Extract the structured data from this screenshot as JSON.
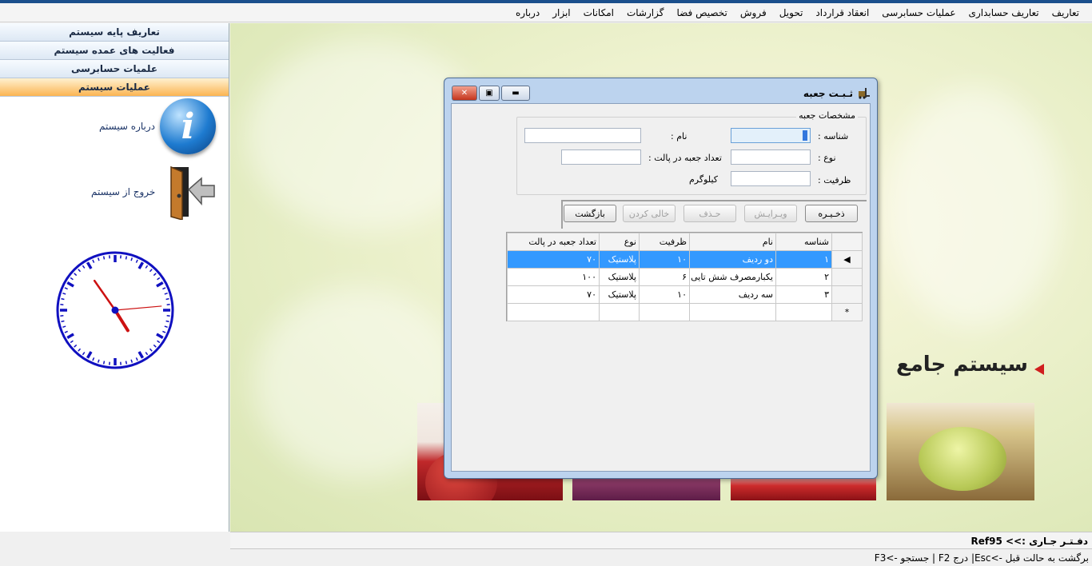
{
  "menu": [
    "تعاریف",
    "تعاریف حسابداری",
    "عملیات حسابرسی",
    "انعقاد قرارداد",
    "تحویل",
    "فروش",
    "تخصیص فضا",
    "گزارشات",
    "امکانات",
    "ابزار",
    "درباره"
  ],
  "sidebar": {
    "buttons": [
      "تعاریف پایه سیستم",
      "فعالیت های عمده سیستم",
      "علمیات حسابرسی",
      "عملیات سیستم"
    ],
    "about_label": "درباره سیستم",
    "exit_label": "خروج از سیستم"
  },
  "banner": {
    "text": "سیستم جامع"
  },
  "dialog": {
    "title": "ثـبـت جعبه",
    "group_label": "مشخصات جعبه",
    "fields": {
      "id_label": "شناسه :",
      "name_label": "نام :",
      "type_label": "نوع :",
      "count_label": "تعداد جعبه در پالت :",
      "capacity_label": "ظرفیت :",
      "unit_label": "کیلوگرم",
      "id_value": "",
      "name_value": "",
      "type_value": "",
      "count_value": "",
      "capacity_value": ""
    },
    "buttons": {
      "save": "ذخـیـره",
      "edit": "ویـرایـش",
      "delete": "حـذف",
      "clear": "خالی کردن",
      "back": "بازگشت"
    },
    "grid": {
      "headers": [
        "شناسه",
        "نام",
        "ظرفیت",
        "نوع",
        "تعداد جعبه در پالت"
      ],
      "rows": [
        [
          "۱",
          "دو ردیف",
          "۱۰",
          "پلاستیک",
          "۷۰"
        ],
        [
          "۲",
          "یکبارمصرف شش تایی",
          "۶",
          "پلاستیک",
          "۱۰۰"
        ],
        [
          "۳",
          "سه ردیف",
          "۱۰",
          "پلاستیک",
          "۷۰"
        ]
      ],
      "new_row_marker": "*"
    }
  },
  "status": {
    "current_office": "دفـتـر جـاری :>> Ref95",
    "hints": "برگشت به حالت قبل ->Esc| درج F2 | جستجو ->F3"
  },
  "colors": {
    "accent": "#fbb452",
    "selection": "#3399ff",
    "title_bar": "#1b4f8c"
  }
}
